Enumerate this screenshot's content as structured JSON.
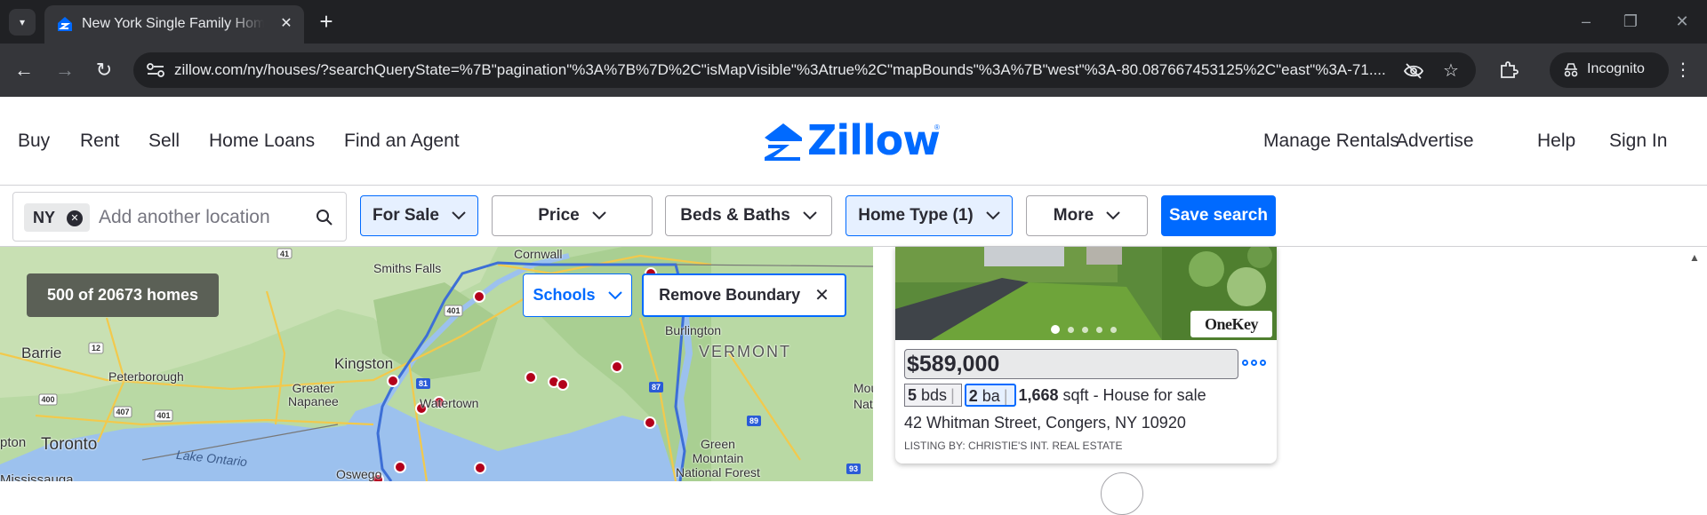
{
  "browser": {
    "tab_title": "New York Single Family Homes",
    "url": "zillow.com/ny/houses/?searchQueryState=%7B\"pagination\"%3A%7B%7D%2C\"isMapVisible\"%3Atrue%2C\"mapBounds\"%3A%7B\"west\"%3A-80.087667453125%2C\"east\"%3A-71....",
    "profile_label": "Incognito",
    "icons": [
      "tab-list-icon",
      "zillow-favicon",
      "close-icon",
      "new-tab-icon",
      "minimize-icon",
      "restore-icon",
      "close-window-icon",
      "back-icon",
      "forward-icon",
      "reload-icon",
      "site-info-icon",
      "eye-off-icon",
      "star-icon",
      "extensions-icon",
      "incognito-icon",
      "kebab-menu-icon"
    ]
  },
  "header": {
    "nav_left": [
      "Buy",
      "Rent",
      "Sell",
      "Home Loans",
      "Find an Agent"
    ],
    "logo_text": "Zillow",
    "nav_right": [
      "Manage Rentals",
      "Advertise",
      "Help",
      "Sign In"
    ],
    "brand_color": "#006aff"
  },
  "filters": {
    "location_chip": "NY",
    "location_placeholder": "Add another location",
    "for_sale": "For Sale",
    "price": "Price",
    "beds_baths": "Beds & Baths",
    "home_type": "Home Type (1)",
    "more": "More",
    "save_search": "Save search"
  },
  "map": {
    "homes_count": "500 of 20673 homes",
    "schools": "Schools",
    "remove_boundary": "Remove Boundary",
    "labels": {
      "cornwall": "Cornwall",
      "smiths_falls": "Smiths Falls",
      "barrie": "Barrie",
      "kingston": "Kingston",
      "peterborough": "Peterborough",
      "greater_napanee": "Greater\nNapanee",
      "watertown": "Watertown",
      "burlington": "Burlington",
      "vermont": "VERMONT",
      "toronto": "Toronto",
      "lake_ontario": "Lake Ontario",
      "mississauga": "Mississauga",
      "oswego": "Oswego",
      "green_mountain": "Green\nMountain\nNational Forest",
      "mou": "Mou",
      "nationa": "Nationa",
      "ptonto": "pton"
    },
    "highways": [
      "41",
      "401",
      "12",
      "400",
      "407",
      "401",
      "81",
      "87",
      "89",
      "93"
    ]
  },
  "listing": {
    "price": "$589,000",
    "beds": "5",
    "beds_unit": "bds",
    "baths": "2",
    "baths_unit": "ba",
    "sqft": "1,668",
    "sqft_unit": "sqft",
    "status": "- House for sale",
    "address": "42 Whitman Street, Congers, NY 10920",
    "listing_by": "LISTING BY: CHRISTIE'S INT. REAL ESTATE",
    "photo_badge": "OneKey",
    "photo_count_dots": 5,
    "photo_active_index": 1
  }
}
